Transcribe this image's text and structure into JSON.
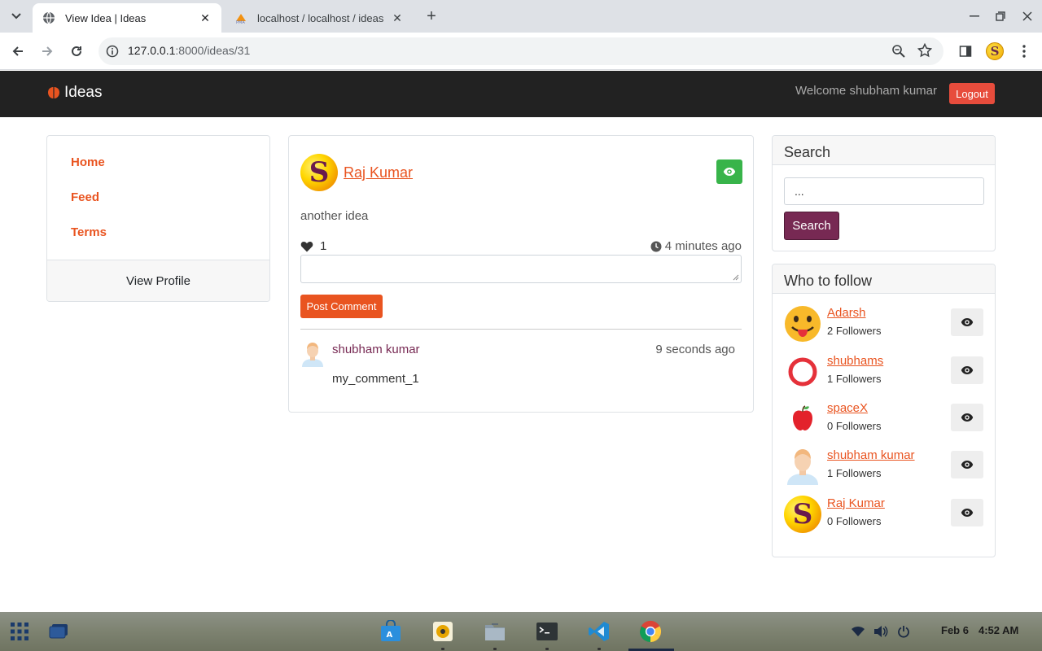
{
  "browser": {
    "tabs": [
      {
        "title": "View Idea | Ideas",
        "active": true
      },
      {
        "title": "localhost / localhost / ideas",
        "active": false
      }
    ],
    "url_host": "127.0.0.1",
    "url_rest": ":8000/ideas/31"
  },
  "site": {
    "brand": "Ideas",
    "welcome": "Welcome shubham kumar",
    "logout_label": "Logout",
    "colors": {
      "primary": "#e95420",
      "secondary": "#772953",
      "success": "#38b44a",
      "navbar": "#222222"
    }
  },
  "sidebar": {
    "links": [
      {
        "label": "Home"
      },
      {
        "label": "Feed"
      },
      {
        "label": "Terms"
      }
    ],
    "view_profile": "View Profile"
  },
  "idea": {
    "author": "Raj Kumar",
    "author_initial": "S",
    "content": "another idea",
    "likes": "1",
    "time": "4 minutes ago",
    "comment_placeholder": "",
    "post_label": "Post Comment",
    "comments": [
      {
        "user": "shubham kumar",
        "time": "9 seconds ago",
        "text": "my_comment_1"
      }
    ]
  },
  "search": {
    "title": "Search",
    "input_value": "...",
    "button_label": "Search"
  },
  "who_to_follow": {
    "title": "Who to follow",
    "users": [
      {
        "name": "Adarsh",
        "followers": "2 Followers",
        "avatar": "tongue-emoji-icon"
      },
      {
        "name": "shubhams",
        "followers": "1 Followers",
        "avatar": "red-ring-icon"
      },
      {
        "name": "spaceX",
        "followers": "0 Followers",
        "avatar": "apple-icon"
      },
      {
        "name": "shubham kumar",
        "followers": "1 Followers",
        "avatar": "person-icon"
      },
      {
        "name": "Raj Kumar",
        "followers": "0 Followers",
        "avatar": "s-logo-icon"
      }
    ]
  },
  "taskbar": {
    "date": "Feb 6",
    "time": "4:52 AM"
  }
}
